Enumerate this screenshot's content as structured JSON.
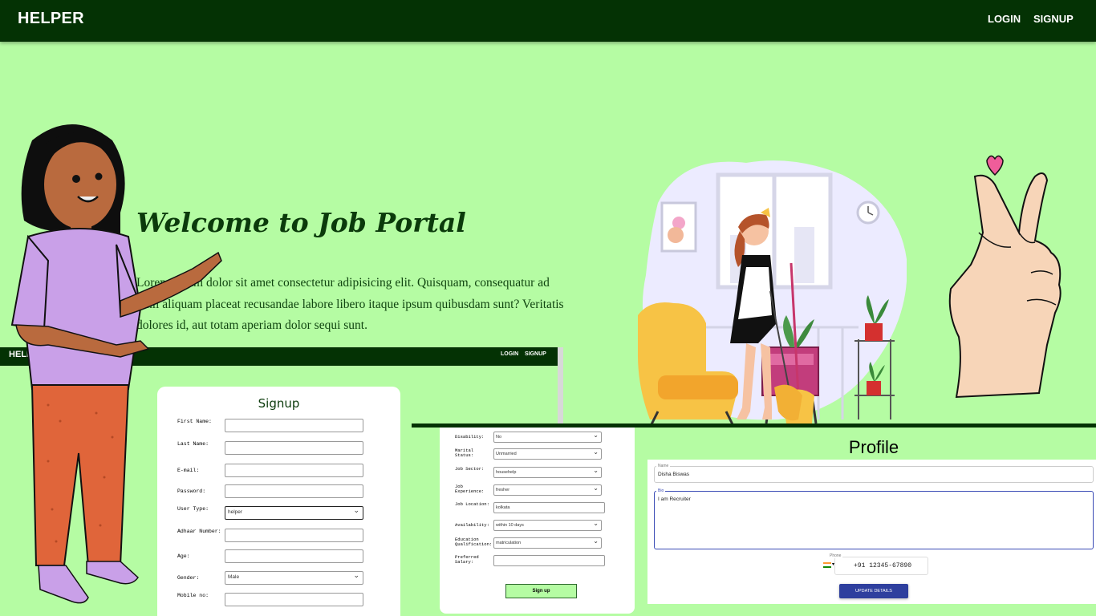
{
  "navbar": {
    "brand": "HELPER",
    "login": "LOGIN",
    "signup": "SIGNUP"
  },
  "hero": {
    "title": "Welcome to Job Portal",
    "text": "Lorem ipsum dolor sit amet consectetur adipisicing elit. Quisquam, consequatur ad nihil aliquam placeat recusandae labore libero itaque ipsum quibusdam sunt? Veritatis dolores id, aut totam aperiam dolor sequi sunt."
  },
  "mini_navbar": {
    "brand": "HELPER",
    "login": "LOGIN",
    "signup": "SIGNUP"
  },
  "signup_form": {
    "title": "Signup",
    "fields": [
      {
        "label": "First Name:",
        "value": ""
      },
      {
        "label": "Last Name:",
        "value": ""
      },
      {
        "label": "E-mail:",
        "value": ""
      },
      {
        "label": "Password:",
        "value": ""
      },
      {
        "label": "User Type:",
        "value": "helper"
      },
      {
        "label": "Adhaar Number:",
        "value": ""
      },
      {
        "label": "Age:",
        "value": ""
      },
      {
        "label": "Gender:",
        "value": "Male"
      },
      {
        "label": "Mobile no:",
        "value": ""
      }
    ]
  },
  "signup_form_2": {
    "fields": [
      {
        "label": "Disability:",
        "value": "No"
      },
      {
        "label": "Marital Status:",
        "value": "Unmarried"
      },
      {
        "label": "Job Sector:",
        "value": "househelp"
      },
      {
        "label": "Job Experience:",
        "value": "fresher"
      },
      {
        "label": "Job Location:",
        "value": "kolkata"
      },
      {
        "label": "Availability:",
        "value": "within 10 days"
      },
      {
        "label": "Education Qualification:",
        "value": "matriculation"
      },
      {
        "label": "Preferred Salary:",
        "value": ""
      }
    ],
    "button": "Sign up"
  },
  "profile": {
    "title": "Profile",
    "name_label": "Name",
    "name_value": "Disha Biswas",
    "bio_label": "Bio",
    "bio_value": "I am Recruiter",
    "phone_label": "Phone",
    "phone_value": "+91 12345-67890",
    "update_button": "UPDATE DETAILS"
  },
  "colors": {
    "navbar": "#043204",
    "background": "#b5fca3",
    "button_primary": "#2e3f9e"
  }
}
